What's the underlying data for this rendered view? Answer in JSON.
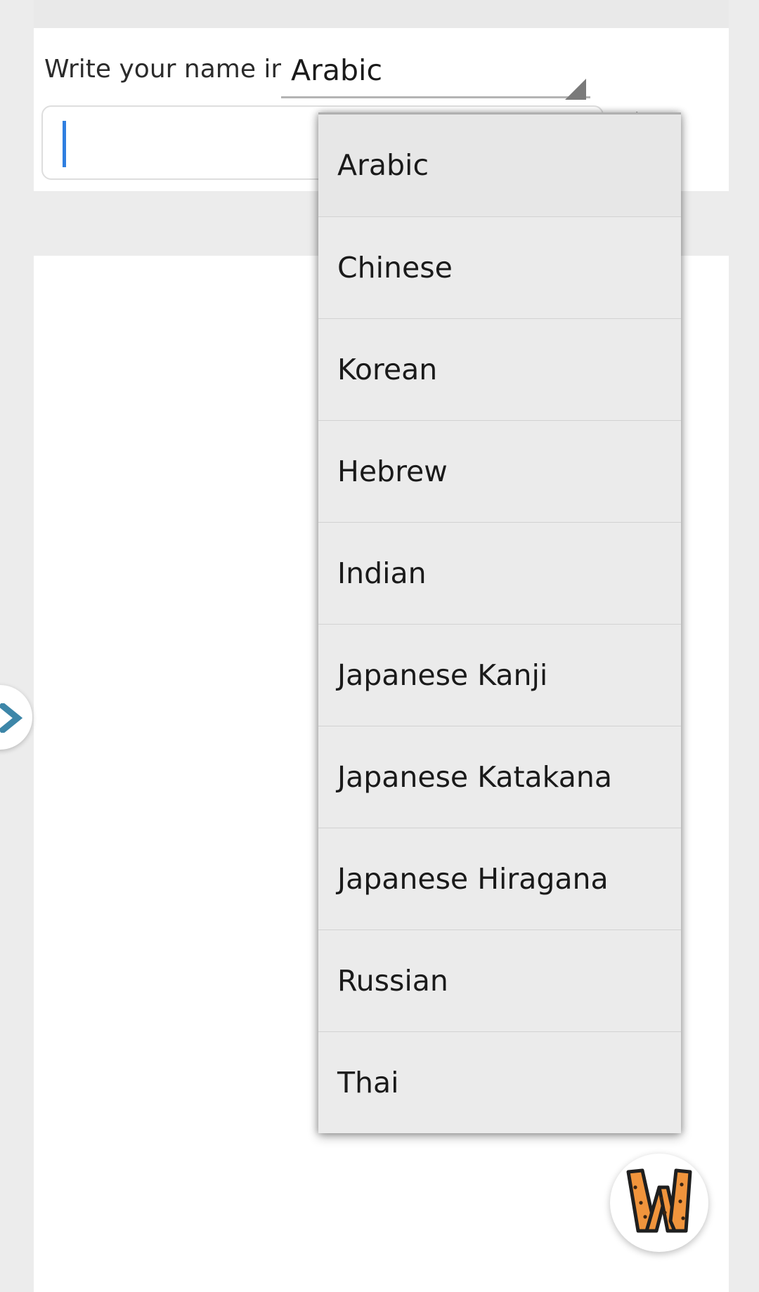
{
  "app": {
    "accent_color": "#e8903b",
    "caret_color": "#2f7fe0",
    "dropdown_bg": "#ebebeb",
    "panel_bg": "#ffffff",
    "page_bg": "#ececec"
  },
  "form": {
    "prompt_label": "Write your name in..",
    "spinner": {
      "selected_value": "Arabic",
      "caret_icon": "dropdown-triangle-icon",
      "expanded": true
    },
    "name_input": {
      "value": "",
      "placeholder": ""
    },
    "pencil_icon": "pencil-icon"
  },
  "dropdown": {
    "items": [
      {
        "label": "Arabic"
      },
      {
        "label": "Chinese"
      },
      {
        "label": "Korean"
      },
      {
        "label": "Hebrew"
      },
      {
        "label": "Indian"
      },
      {
        "label": "Japanese Kanji"
      },
      {
        "label": "Japanese Katakana"
      },
      {
        "label": "Japanese Hiragana"
      },
      {
        "label": "Russian"
      },
      {
        "label": "Thai"
      }
    ],
    "selected_index": 0
  },
  "side_handle": {
    "icon": "chevron-right-icon"
  },
  "badge": {
    "icon": "w-logo-icon",
    "letter": "W"
  }
}
